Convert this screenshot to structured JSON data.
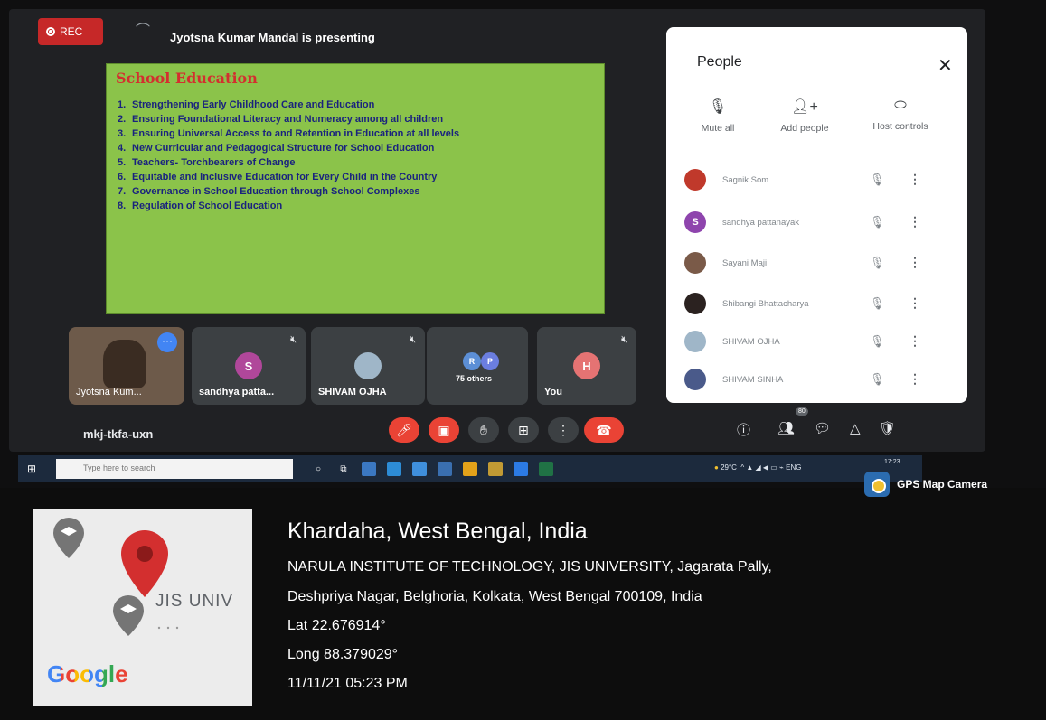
{
  "recording": {
    "label": "REC"
  },
  "presenter": {
    "text": "Jyotsna Kumar Mandal is presenting"
  },
  "slide": {
    "title": "School Education",
    "items": [
      {
        "n": "1.",
        "text": "Strengthening Early Childhood Care and Education"
      },
      {
        "n": "2.",
        "text": "Ensuring Foundational Literacy and Numeracy among all children"
      },
      {
        "n": "3.",
        "text": "Ensuring Universal Access to and Retention in Education at all levels"
      },
      {
        "n": "4.",
        "text": "New Curricular and Pedagogical Structure for School Education"
      },
      {
        "n": "5.",
        "text": "Teachers- Torchbearers of Change"
      },
      {
        "n": "6.",
        "text": "Equitable and Inclusive Education for Every Child in the Country"
      },
      {
        "n": "7.",
        "text": "Governance in School Education through School Complexes"
      },
      {
        "n": "8.",
        "text": "Regulation of School Education"
      }
    ]
  },
  "tiles": [
    {
      "name": "Jyotsna Kum..."
    },
    {
      "name": "sandhya patta...",
      "initial": "S"
    },
    {
      "name": "SHIVAM OJHA"
    },
    {
      "name": "75 others",
      "initials": [
        "R",
        "P"
      ]
    },
    {
      "name": "You",
      "initial": "H"
    }
  ],
  "meeting": {
    "code": "mkj-tkfa-uxn",
    "participant_count": "80"
  },
  "people_panel": {
    "title": "People",
    "actions": [
      {
        "label": "Mute all",
        "icon": "mic-off-icon"
      },
      {
        "label": "Add people",
        "icon": "add-person-icon"
      },
      {
        "label": "Host controls",
        "icon": "toggle-icon"
      }
    ],
    "participants": [
      {
        "name": "Sagnik Som"
      },
      {
        "name": "sandhya pattanayak",
        "initial": "S"
      },
      {
        "name": "Sayani Maji"
      },
      {
        "name": "Shibangi Bhattacharya"
      },
      {
        "name": "SHIVAM OJHA"
      },
      {
        "name": "SHIVAM SINHA"
      }
    ]
  },
  "taskbar": {
    "search_placeholder": "Type here to search",
    "weather": "29°C",
    "lang": "ENG",
    "time": "17:23"
  },
  "gps": {
    "brand": "GPS Map Camera",
    "map_label": "JIS UNIV",
    "map_logo": "Google",
    "city": "Khardaha, West Bengal, India",
    "address_line1": "NARULA INSTITUTE OF TECHNOLOGY, JIS UNIVERSITY, Jagarata Pally,",
    "address_line2": "Deshpriya Nagar, Belghoria, Kolkata, West Bengal 700109, India",
    "lat": "Lat 22.676914°",
    "long": "Long 88.379029°",
    "datetime": "11/11/21 05:23 PM"
  },
  "colors": {
    "meet_bg": "#202124",
    "slide_green": "#8bc34a",
    "slide_title": "#d32f2f",
    "danger": "#ea4335",
    "map_pin": "#d32f2f"
  }
}
